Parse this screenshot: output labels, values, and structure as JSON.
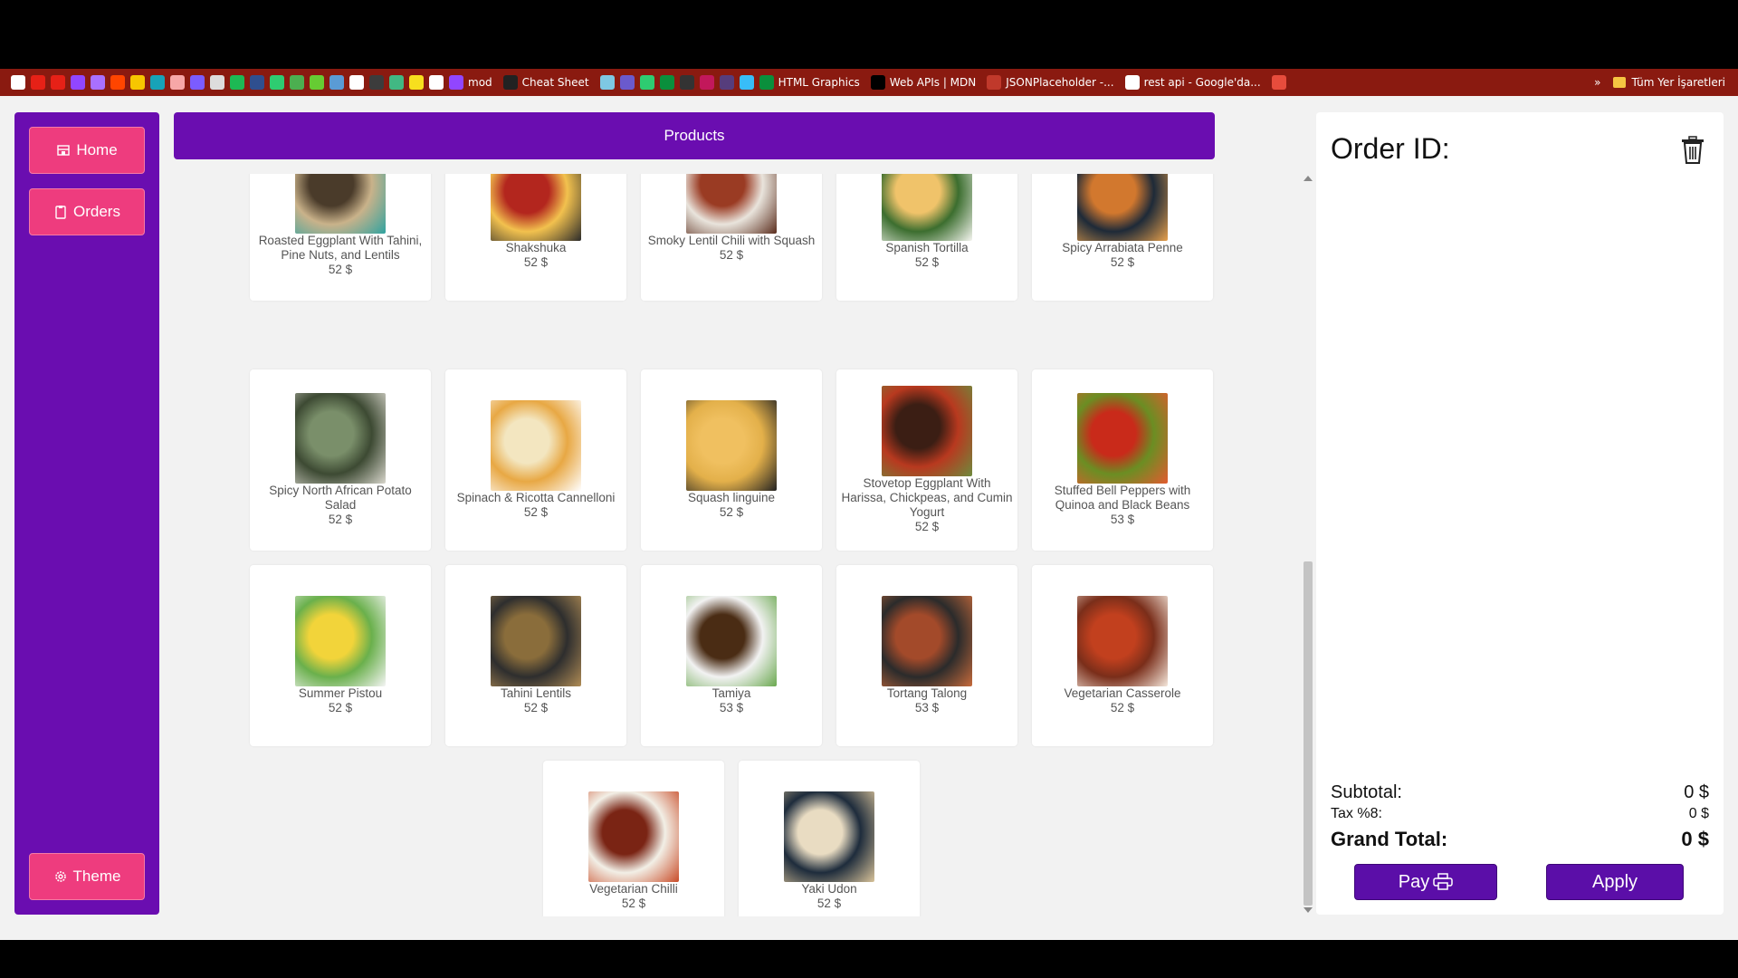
{
  "bookmarks": {
    "items": [
      {
        "label": "",
        "color": "#ffffff"
      },
      {
        "label": "",
        "color": "#e62117"
      },
      {
        "label": "",
        "color": "#e62117"
      },
      {
        "label": "",
        "color": "#9146ff"
      },
      {
        "label": "",
        "color": "#a970ff"
      },
      {
        "label": "",
        "color": "#ff4500"
      },
      {
        "label": "",
        "color": "#f7c600"
      },
      {
        "label": "",
        "color": "#17a2b8"
      },
      {
        "label": "",
        "color": "#f7a7a7"
      },
      {
        "label": "",
        "color": "#7b5cff"
      },
      {
        "label": "",
        "color": "#dddddd"
      },
      {
        "label": "",
        "color": "#1db954"
      },
      {
        "label": "",
        "color": "#2f4f8f"
      },
      {
        "label": "",
        "color": "#2ecc71"
      },
      {
        "label": "",
        "color": "#4caf50"
      },
      {
        "label": "",
        "color": "#66cc33"
      },
      {
        "label": "",
        "color": "#5a9bd5"
      },
      {
        "label": "",
        "color": "#ffffff"
      },
      {
        "label": "",
        "color": "#3c3c3c"
      },
      {
        "label": "",
        "color": "#41b883"
      },
      {
        "label": "",
        "color": "#f7df1e"
      },
      {
        "label": "",
        "color": "#ffffff"
      },
      {
        "label": "mod",
        "color": "#9146ff"
      },
      {
        "label": "Cheat Sheet",
        "color": "#222222"
      },
      {
        "label": "",
        "color": "#7ec8e3"
      },
      {
        "label": "",
        "color": "#6a5acd"
      },
      {
        "label": "",
        "color": "#2ecc71"
      },
      {
        "label": "",
        "color": "#0a8f3c"
      },
      {
        "label": "",
        "color": "#333333"
      },
      {
        "label": "",
        "color": "#c2185b"
      },
      {
        "label": "",
        "color": "#563d7c"
      },
      {
        "label": "",
        "color": "#38bdf8"
      },
      {
        "label": "HTML Graphics",
        "color": "#0a8f3c"
      },
      {
        "label": "Web APIs | MDN",
        "color": "#000000"
      },
      {
        "label": "JSONPlaceholder -...",
        "color": "#c0392b"
      },
      {
        "label": "rest api - Google'da...",
        "color": "#ffffff"
      },
      {
        "label": "",
        "color": "#e74c3c"
      }
    ],
    "overflow": "»",
    "all_bookmarks": "Tüm Yer İşaretleri",
    "folder_color": "#f5c542"
  },
  "nav": {
    "home": "Home",
    "orders": "Orders",
    "theme": "Theme"
  },
  "header": {
    "title": "Products"
  },
  "products": [
    {
      "name": "Roasted Eggplant With Tahini, Pine Nuts, and Lentils",
      "price": "52 $",
      "colors": [
        "#4a3b2a",
        "#c9b28a",
        "#2fa3a0"
      ]
    },
    {
      "name": "Shakshuka",
      "price": "52 $",
      "colors": [
        "#b3261e",
        "#f2c14e",
        "#2b2b2b"
      ]
    },
    {
      "name": "Smoky Lentil Chili with Squash",
      "price": "52 $",
      "colors": [
        "#9a3b23",
        "#e9e4dc",
        "#5a2c1c"
      ]
    },
    {
      "name": "Spanish Tortilla",
      "price": "52 $",
      "colors": [
        "#f0c36a",
        "#3c6e2f",
        "#f5f5f0"
      ]
    },
    {
      "name": "Spicy Arrabiata Penne",
      "price": "52 $",
      "colors": [
        "#d2782e",
        "#1e2a38",
        "#e7a04c"
      ]
    },
    {
      "name": "Spicy North African Potato Salad",
      "price": "52 $",
      "colors": [
        "#7a8f6a",
        "#3d4a33",
        "#d8d6cc"
      ]
    },
    {
      "name": "Spinach & Ricotta Cannelloni",
      "price": "52 $",
      "colors": [
        "#f3e6c0",
        "#e8a844",
        "#ffffff"
      ]
    },
    {
      "name": "Squash linguine",
      "price": "52 $",
      "colors": [
        "#f0c060",
        "#e3b04a",
        "#222222"
      ]
    },
    {
      "name": "Stovetop Eggplant With Harissa, Chickpeas, and Cumin Yogurt",
      "price": "52 $",
      "colors": [
        "#3b1e14",
        "#b8391f",
        "#6e8b3d"
      ]
    },
    {
      "name": "Stuffed Bell Peppers with Quinoa and Black Beans",
      "price": "53 $",
      "colors": [
        "#c92a1a",
        "#6b8e23",
        "#e35b2f"
      ]
    },
    {
      "name": "Summer Pistou",
      "price": "52 $",
      "colors": [
        "#f2d43a",
        "#6ab04c",
        "#f5f5f5"
      ]
    },
    {
      "name": "Tahini Lentils",
      "price": "52 $",
      "colors": [
        "#8a6d3b",
        "#2e2e2e",
        "#b08c55"
      ]
    },
    {
      "name": "Tamiya",
      "price": "53 $",
      "colors": [
        "#4a2c14",
        "#f2f2f2",
        "#6aa84f"
      ]
    },
    {
      "name": "Tortang Talong",
      "price": "53 $",
      "colors": [
        "#a34a2a",
        "#2b2b2b",
        "#c76b3c"
      ]
    },
    {
      "name": "Vegetarian Casserole",
      "price": "52 $",
      "colors": [
        "#c2401e",
        "#7a2e1a",
        "#f5e8dc"
      ]
    },
    {
      "name": "Vegetarian Chilli",
      "price": "52 $",
      "colors": [
        "#7a2414",
        "#f2efe6",
        "#c94b27"
      ]
    },
    {
      "name": "Yaki Udon",
      "price": "52 $",
      "colors": [
        "#e9dcc2",
        "#1e2c3c",
        "#d9c39a"
      ]
    }
  ],
  "order": {
    "title": "Order ID:",
    "subtotal_label": "Subtotal:",
    "subtotal_value": "0 $",
    "tax_label": "Tax %8:",
    "tax_value": "0 $",
    "grand_label": "Grand Total:",
    "grand_value": "0 $",
    "pay_label": "Pay",
    "apply_label": "Apply"
  },
  "colors": {
    "accent": "#6a0db0",
    "nav_button": "#ee3c7e",
    "pay_button": "#5b0ea8"
  }
}
